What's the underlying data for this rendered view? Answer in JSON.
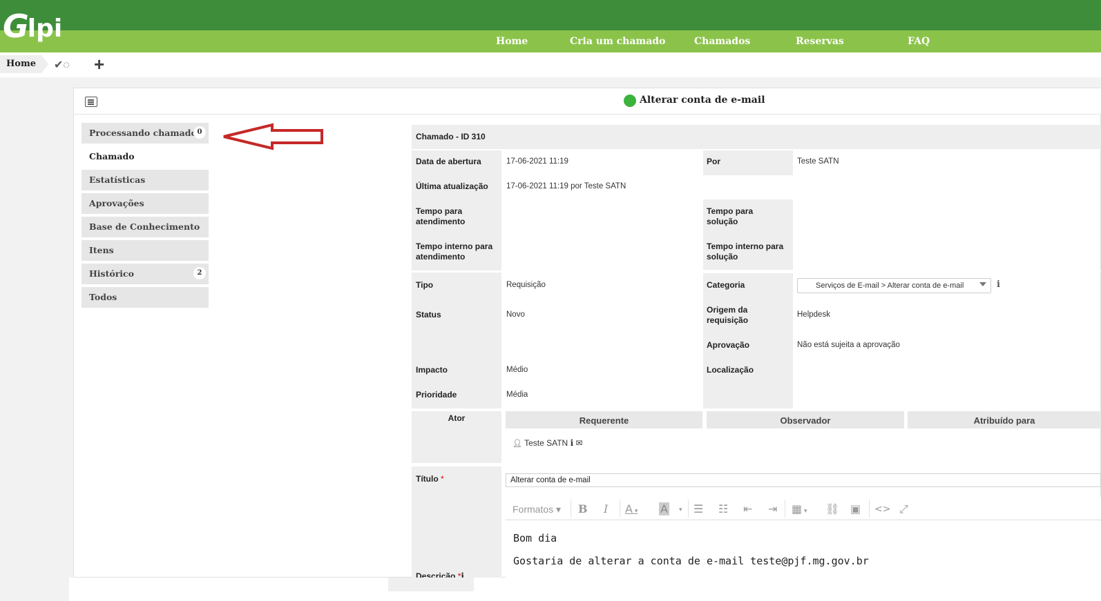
{
  "app": {
    "logo_g": "G",
    "logo_rest": "lpi"
  },
  "nav": [
    "Home",
    "Cria um chamado",
    "Chamados",
    "Reservas",
    "FAQ"
  ],
  "breadcrumb": {
    "home": "Home"
  },
  "panel": {
    "title": "Alterar conta de e-mail"
  },
  "tabs": [
    {
      "label": "Processando chamado",
      "badge": "0"
    },
    {
      "label": "Chamado"
    },
    {
      "label": "Estatísticas"
    },
    {
      "label": "Aprovações"
    },
    {
      "label": "Base de Conhecimento"
    },
    {
      "label": "Itens"
    },
    {
      "label": "Histórico",
      "badge": "2"
    },
    {
      "label": "Todos"
    }
  ],
  "ticket": {
    "header": "Chamado - ID 310",
    "opened_label": "Data de abertura",
    "opened_value": "17-06-2021 11:19",
    "by_label": "Por",
    "by_value": "Teste SATN",
    "updated_label": "Última atualização",
    "updated_value": "17-06-2021 11:19 por Teste SATN",
    "time_service_label": "Tempo para atendimento",
    "time_solution_label": "Tempo para solução",
    "internal_service_label": "Tempo interno para atendimento",
    "internal_solution_label": "Tempo interno para solução",
    "type_label": "Tipo",
    "type_value": "Requisição",
    "category_label": "Categoria",
    "category_value": "Serviços de E-mail > Alterar conta de e-mail",
    "status_label": "Status",
    "status_value": "Novo",
    "origin_label": "Origem da requisição",
    "origin_value": "Helpdesk",
    "approval_label": "Aprovação",
    "approval_value": "Não está sujeita a aprovação",
    "impact_label": "Impacto",
    "impact_value": "Médio",
    "location_label": "Localização",
    "priority_label": "Prioridade",
    "priority_value": "Média",
    "actor_label": "Ator",
    "requester_label": "Requerente",
    "observer_label": "Observador",
    "assigned_label": "Atribuído para",
    "requester_name": "Teste SATN",
    "title_label": "Título",
    "title_value": "Alterar conta de e-mail",
    "description_label": "Descrição",
    "formats_label": "Formatos",
    "description_lines": [
      "Bom dia",
      "Gostaria de alterar a conta de e-mail teste@pjf.mg.gov.br"
    ]
  },
  "colors": {
    "top_green": "#3e8d3a",
    "nav_green": "#8bc34a",
    "status_green": "#3cb33c",
    "arrow_red": "#c62828"
  },
  "icons": [
    "check-icon",
    "plus-icon",
    "list-icon",
    "user-icon",
    "info-icon",
    "envelope-icon"
  ]
}
